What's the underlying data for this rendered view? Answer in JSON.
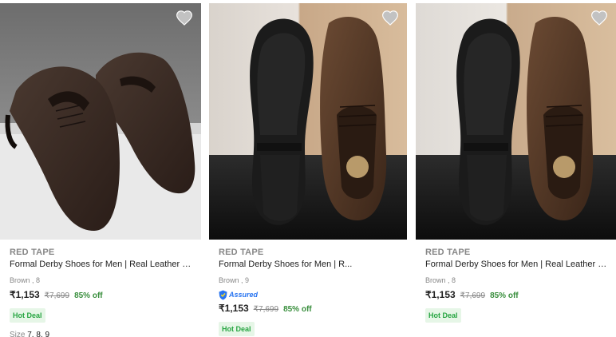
{
  "products": [
    {
      "brand": "RED TAPE",
      "title": "Formal Derby Shoes for Men | Real Leather S...",
      "variant": "Brown , 8",
      "price": "₹1,153",
      "mrp": "₹7,699",
      "discount": "85% off",
      "deal": "Hot Deal",
      "size_label": "Size",
      "sizes": "7, 8, 9",
      "wishlist_icon": "heart-icon"
    },
    {
      "brand": "RED TAPE",
      "title": "Formal Derby Shoes for Men | R...",
      "variant": "Brown , 9",
      "assured": "Assured",
      "price": "₹1,153",
      "mrp": "₹7,699",
      "discount": "85% off",
      "deal": "Hot Deal",
      "wishlist_icon": "heart-icon"
    },
    {
      "brand": "RED TAPE",
      "title": "Formal Derby Shoes for Men | Real Leather S...",
      "variant": "Brown , 8",
      "price": "₹1,153",
      "mrp": "₹7,699",
      "discount": "85% off",
      "deal": "Hot Deal",
      "wishlist_icon": "heart-icon"
    }
  ],
  "colors": {
    "brand_gray": "#878787",
    "discount_green": "#388e3c",
    "deal_bg": "#e6f6e7",
    "assured_blue": "#2874f0",
    "shoe_brown": "#3b2a22"
  }
}
